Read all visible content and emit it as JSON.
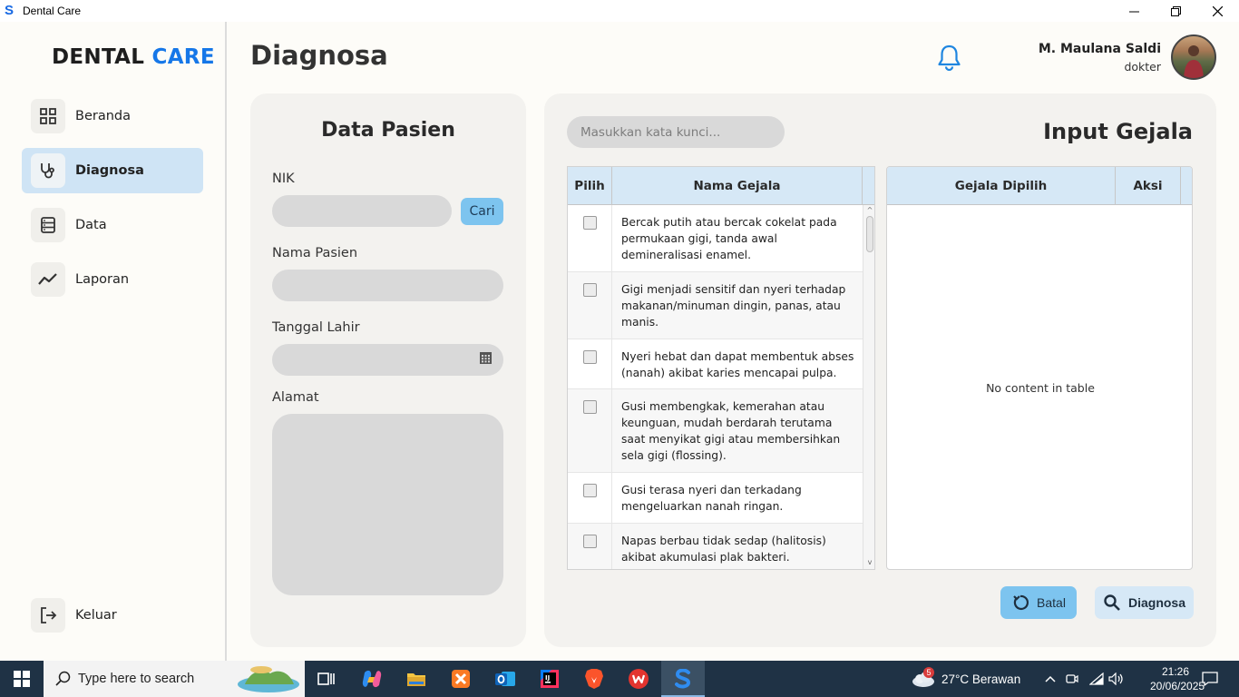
{
  "window": {
    "title": "Dental Care",
    "minimize": "—",
    "maximize": "❐",
    "close": "✕"
  },
  "sidebar": {
    "logo_part1": "DENTAL",
    "logo_part2": "CARE",
    "items": [
      {
        "label": "Beranda",
        "icon": "grid-icon",
        "active": false
      },
      {
        "label": "Diagnosa",
        "icon": "stethoscope-icon",
        "active": true
      },
      {
        "label": "Data",
        "icon": "database-icon",
        "active": false
      },
      {
        "label": "Laporan",
        "icon": "trend-chart-icon",
        "active": false
      }
    ],
    "logout_label": "Keluar"
  },
  "header": {
    "title": "Diagnosa",
    "user_name": "M. Maulana Saldi",
    "user_role": "dokter"
  },
  "patient": {
    "title": "Data Pasien",
    "nik_label": "NIK",
    "nik_value": "",
    "search_button": "Cari",
    "name_label": "Nama Pasien",
    "name_value": "",
    "dob_label": "Tanggal Lahir",
    "dob_value": "",
    "address_label": "Alamat",
    "address_value": ""
  },
  "symptoms": {
    "title": "Input Gejala",
    "search_placeholder": "Masukkan kata kunci...",
    "table_headers": {
      "pick": "Pilih",
      "name": "Nama Gejala"
    },
    "rows": [
      {
        "checked": false,
        "text": "Bercak putih atau bercak cokelat pada permukaan gigi, tanda awal demineralisasi enamel."
      },
      {
        "checked": false,
        "text": "Gigi menjadi sensitif dan nyeri terhadap makanan/minuman dingin, panas, atau manis."
      },
      {
        "checked": false,
        "text": "Nyeri hebat dan dapat membentuk abses (nanah) akibat karies mencapai pulpa."
      },
      {
        "checked": false,
        "text": "Gusi membengkak, kemerahan atau keunguan, mudah berdarah terutama saat menyikat gigi atau membersihkan sela gigi (flossing)."
      },
      {
        "checked": false,
        "text": "Gusi terasa nyeri dan terkadang mengeluarkan nanah ringan."
      },
      {
        "checked": false,
        "text": "Napas berbau tidak sedap (halitosis) akibat akumulasi plak bakteri."
      }
    ],
    "selected_headers": {
      "selected": "Gejala Dipilih",
      "action": "Aksi"
    },
    "empty_message": "No content in table",
    "cancel_button": "Batal",
    "diagnose_button": "Diagnosa"
  },
  "taskbar": {
    "search_text": "Type here to search",
    "weather_badge": "5",
    "weather": "27°C  Berawan",
    "time": "21:26",
    "date": "20/06/2025"
  },
  "colors": {
    "accent": "#1677e8",
    "button_primary": "#7dc4ef",
    "button_secondary": "#d6e8f6",
    "active_nav": "#cfe4f5",
    "field": "#d9d9d9",
    "card": "#f3f2ef",
    "taskbar": "#1f3245"
  }
}
